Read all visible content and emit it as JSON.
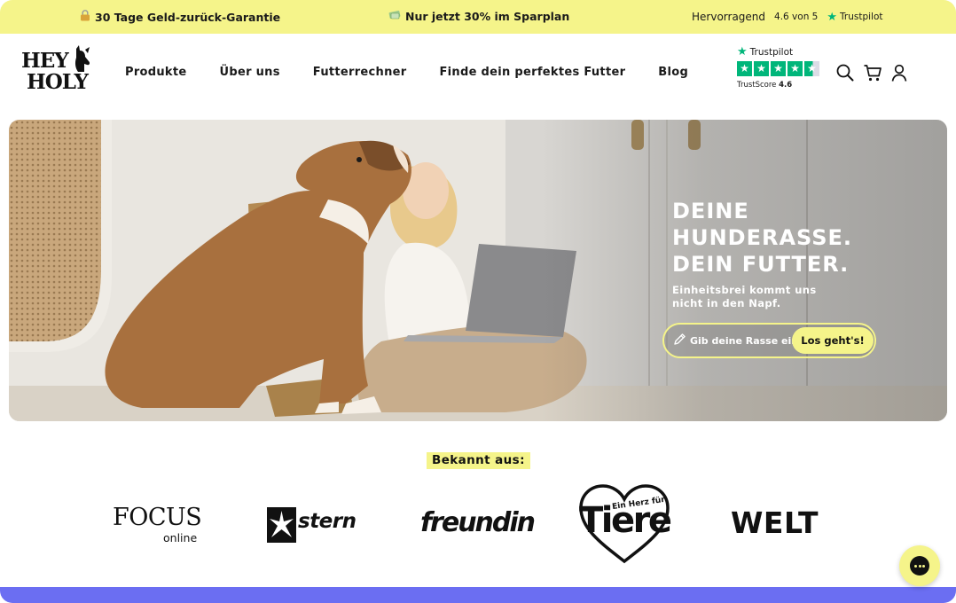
{
  "topbar": {
    "guarantee_icon": "lock-icon",
    "guarantee": "30 Tage Geld-zurück-Garantie",
    "offer_icon": "money-icon",
    "offer": "Nur jetzt 30% im Sparplan",
    "rating_word": "Hervorragend",
    "rating_score": "4.6 von 5",
    "trustpilot": "Trustpilot"
  },
  "header": {
    "logo_line1": "HEY",
    "logo_line2": "HOLY",
    "nav": [
      "Produkte",
      "Über uns",
      "Futterrechner",
      "Finde dein perfektes Futter",
      "Blog"
    ],
    "trustpilot_brand": "Trustpilot",
    "trustscore_label": "TrustScore",
    "trustscore_value": "4.6",
    "trustpilot_stars": 4.6,
    "icons": [
      "search-icon",
      "cart-icon",
      "user-icon"
    ]
  },
  "hero": {
    "title_lines": [
      "DEINE",
      "HUNDERASSE.",
      "DEIN FUTTER."
    ],
    "subtitle": "Einheitsbrei kommt uns nicht in den Napf.",
    "input_placeholder": "Gib deine Rasse ein",
    "cta": "Los geht's!"
  },
  "press": {
    "label": "Bekannt aus:",
    "logos": {
      "focus_main": "FOCUS",
      "focus_sub": "online",
      "stern": "stern",
      "freundin": "freundin",
      "tiere_small": "Ein Herz für",
      "tiere_big": "Tiere",
      "welt": "WELT"
    }
  },
  "colors": {
    "accent_yellow": "#f5f48a",
    "trustpilot_green": "#00b67a",
    "footer_bar": "#6b6ef2"
  }
}
